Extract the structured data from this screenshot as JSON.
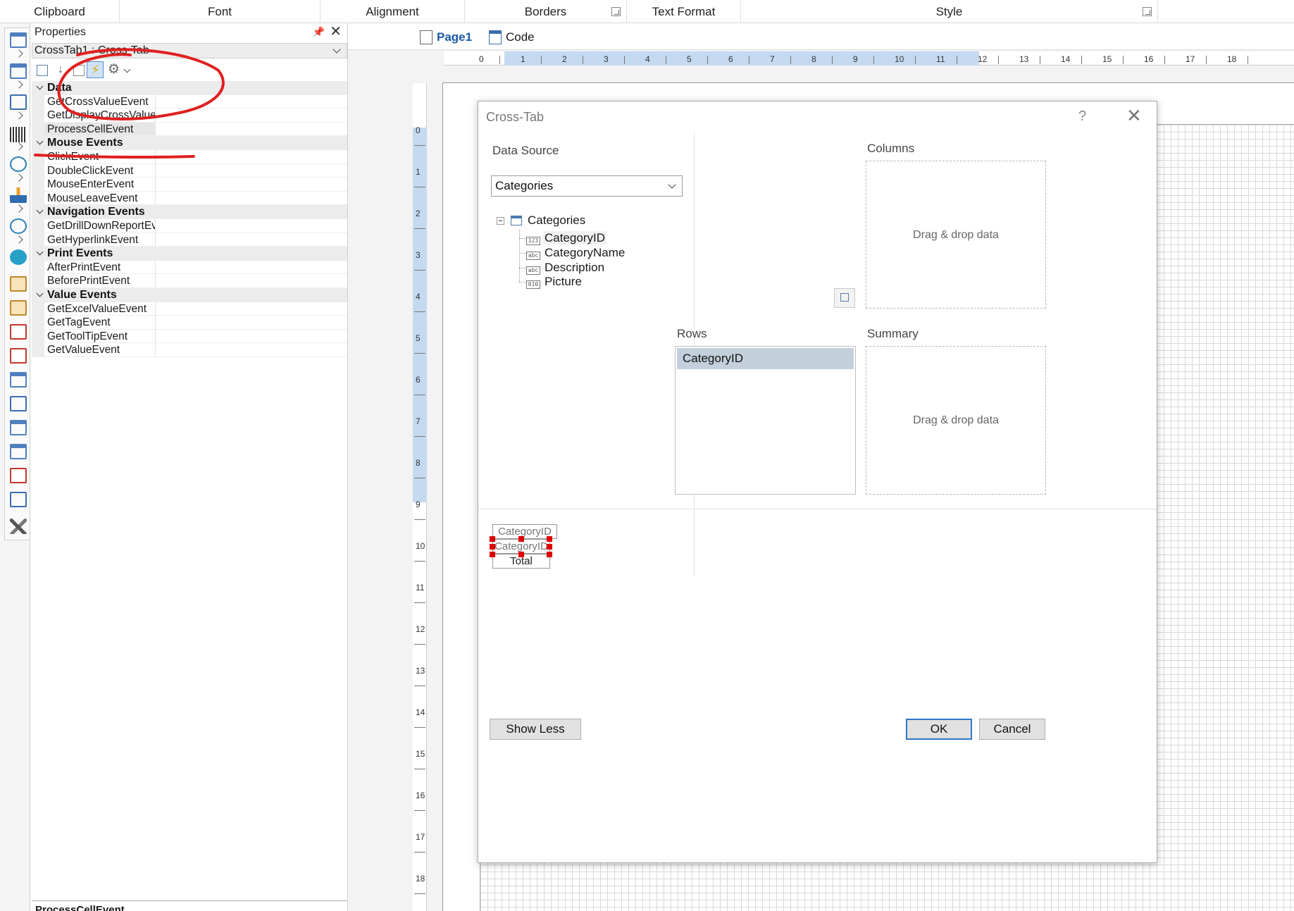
{
  "ribbon": {
    "groups": [
      "Clipboard",
      "Font",
      "Alignment",
      "Borders",
      "Text Format",
      "Style"
    ]
  },
  "toolbox": {
    "items": [
      "page-icon",
      "band-icon",
      "text-icon",
      "barcode-icon",
      "shape-icon",
      "chart-icon",
      "gauge-icon",
      "map-icon",
      "header-band-icon",
      "data-band-icon",
      "text-component-icon",
      "rich-text-icon",
      "panel-icon",
      "container-icon",
      "table-icon",
      "list-icon",
      "richtext-icon",
      "image-icon",
      "tools-icon"
    ]
  },
  "properties": {
    "title": "Properties",
    "pin_icon": "pin-icon",
    "close_icon": "close-icon",
    "object": "CrossTab1 : Cross-Tab",
    "categories": [
      {
        "name": "Data",
        "events": [
          "GetCrossValueEvent",
          "GetDisplayCrossValueEvent",
          "ProcessCellEvent"
        ]
      },
      {
        "name": "Mouse Events",
        "events": [
          "ClickEvent",
          "DoubleClickEvent",
          "MouseEnterEvent",
          "MouseLeaveEvent"
        ]
      },
      {
        "name": "Navigation Events",
        "events": [
          "GetDrillDownReportEvent",
          "GetHyperlinkEvent"
        ]
      },
      {
        "name": "Print Events",
        "events": [
          "AfterPrintEvent",
          "BeforePrintEvent"
        ]
      },
      {
        "name": "Value Events",
        "events": [
          "GetExcelValueEvent",
          "GetTagEvent",
          "GetToolTipEvent",
          "GetValueEvent"
        ]
      }
    ],
    "selected_event": "ProcessCellEvent",
    "footer": "ProcessCellEvent"
  },
  "designer": {
    "tabs": [
      "Page1",
      "Code"
    ],
    "active_tab": "Page1",
    "h_ruler": [
      "0",
      "1",
      "2",
      "3",
      "4",
      "5",
      "6",
      "7",
      "8",
      "9",
      "10",
      "11",
      "12",
      "13",
      "14",
      "15",
      "16",
      "17",
      "18"
    ],
    "v_ruler": [
      "0",
      "1",
      "2",
      "3",
      "4",
      "5",
      "6",
      "7",
      "8",
      "9",
      "10",
      "11",
      "12",
      "13",
      "14",
      "15",
      "16",
      "17",
      "18"
    ]
  },
  "dialog": {
    "title": "Cross-Tab",
    "help": "?",
    "data_source_label": "Data Source",
    "data_source_value": "Categories",
    "tree": {
      "root": "Categories",
      "fields": [
        {
          "name": "CategoryID",
          "type": "123"
        },
        {
          "name": "CategoryName",
          "type": "abc"
        },
        {
          "name": "Description",
          "type": "abc"
        },
        {
          "name": "Picture",
          "type": "010"
        }
      ]
    },
    "columns_label": "Columns",
    "rows_label": "Rows",
    "summary_label": "Summary",
    "drop_hint": "Drag & drop data",
    "rows_items": [
      "CategoryID"
    ],
    "preview": {
      "column_header": "CategoryID",
      "row_header": "CategoryID",
      "total": "Total"
    },
    "show_less": "Show Less",
    "ok": "OK",
    "cancel": "Cancel"
  },
  "colors": {
    "accent": "#2f77c8",
    "ruler_highlight": "#c5d9f1",
    "selection_handle": "#e00000",
    "annotation": "#e02020",
    "rows_selected": "#c3d0dc"
  }
}
